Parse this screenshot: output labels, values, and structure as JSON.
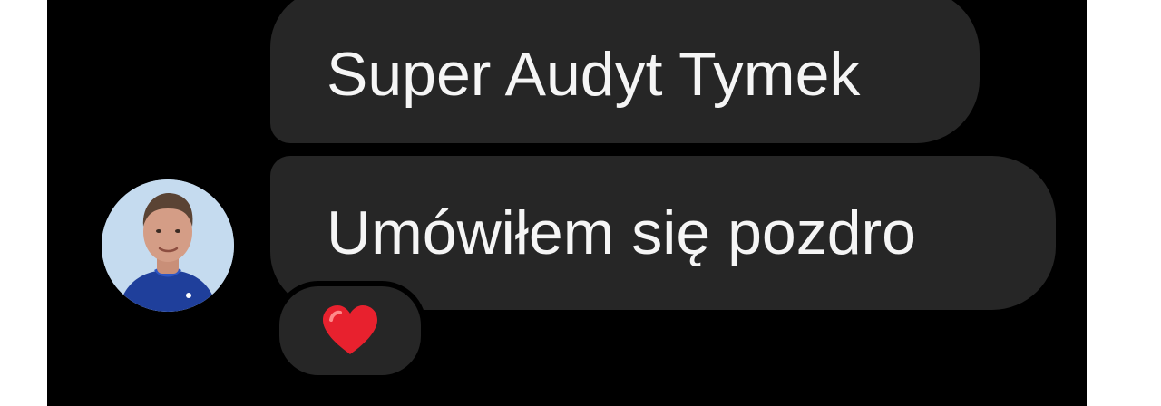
{
  "messages": [
    {
      "text": "Super Audyt Tymek"
    },
    {
      "text": "Umówiłem się pozdro"
    }
  ],
  "reaction": {
    "icon": "heart-icon",
    "color": "#e8212e"
  },
  "colors": {
    "background": "#000000",
    "bubble": "#262626",
    "text": "#f5f5f5"
  }
}
